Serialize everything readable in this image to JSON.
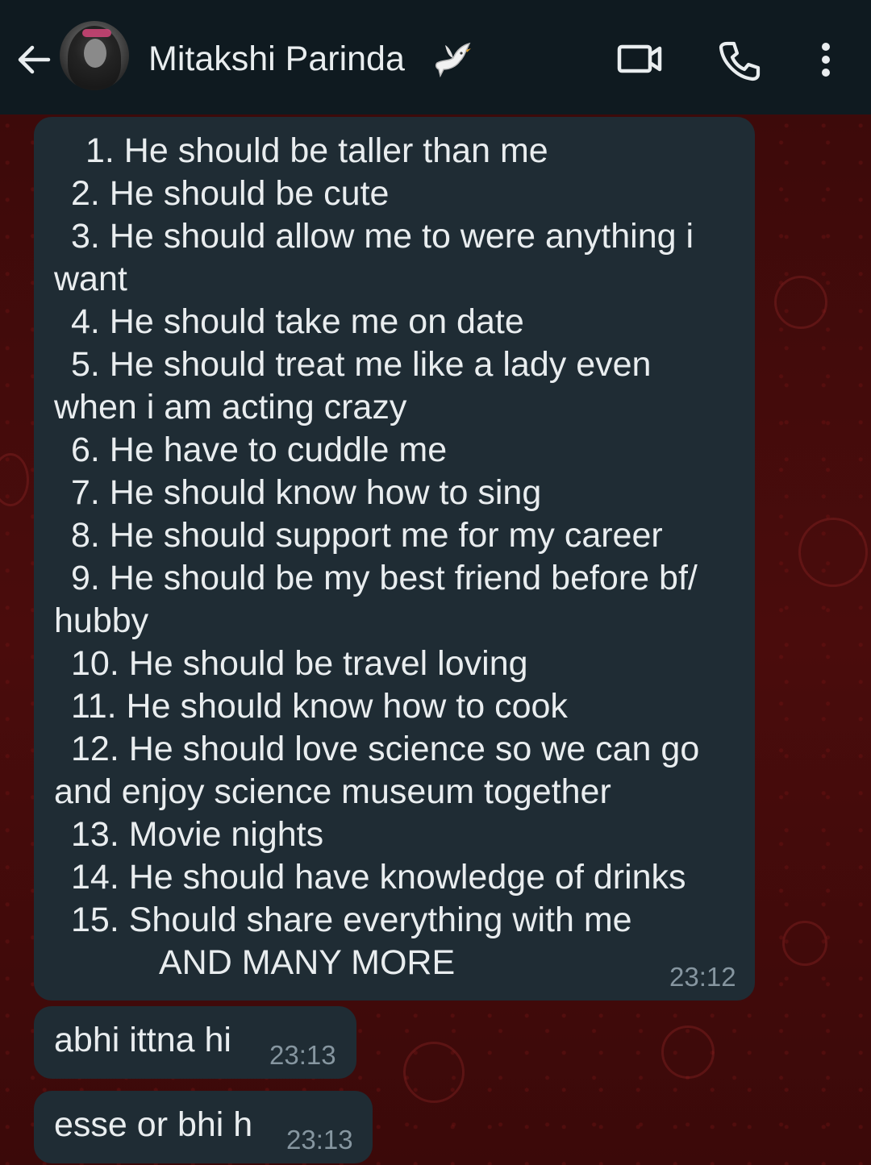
{
  "header": {
    "contact_name": "Mitakshi Parinda",
    "back_icon": "arrow-left-icon",
    "video_icon": "video-call-icon",
    "call_icon": "phone-icon",
    "menu_icon": "more-vert-icon",
    "emoji": "dove-icon"
  },
  "colors": {
    "header_bg": "#0f1a20",
    "bubble_bg": "#1f2c34",
    "text": "#e9edef",
    "timestamp": "#8696a0",
    "wallpaper": "#3d0a0a"
  },
  "messages": [
    {
      "lines": [
        "1. He should be taller than me",
        "2. He should be cute",
        "3. He should allow me to were anything i",
        "want",
        "4. He should take me on date",
        "5. He should treat me like a lady even",
        "when i am acting crazy",
        "6. He have to cuddle me",
        "7. He should know how to sing",
        "8. He should support me for my career",
        "9. He should be my best friend before bf/",
        "hubby",
        "10. He should be travel loving",
        "11. He should know how to cook",
        "12. He should love science so we can go",
        "and enjoy science museum together",
        "13. Movie nights",
        "14. He should have knowledge of drinks",
        "15. Should share everything with me",
        "AND MANY MORE"
      ],
      "time": "23:12"
    },
    {
      "text": "abhi ittna hi",
      "time": "23:13"
    },
    {
      "text": "esse or bhi h",
      "time": "23:13"
    }
  ]
}
